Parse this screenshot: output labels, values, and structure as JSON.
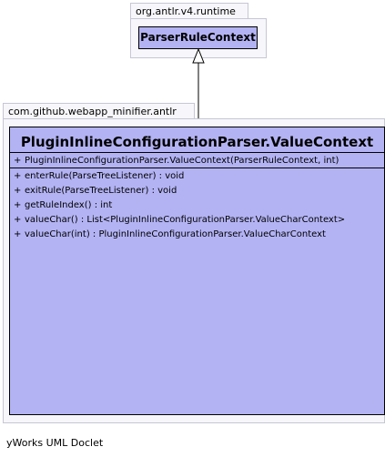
{
  "packages": {
    "runtime": {
      "label": "org.antlr.v4.runtime"
    },
    "minifier": {
      "label": "com.github.webapp_minifier.antlr"
    }
  },
  "parent_class": {
    "name": "ParserRuleContext"
  },
  "main_class": {
    "name": "PluginInlineConfigurationParser.ValueContext",
    "constructors": [
      {
        "visibility": "+",
        "signature": "PluginInlineConfigurationParser.ValueContext(ParserRuleContext, int)"
      }
    ],
    "methods": [
      {
        "visibility": "+",
        "signature": "enterRule(ParseTreeListener) : void"
      },
      {
        "visibility": "+",
        "signature": "exitRule(ParseTreeListener) : void"
      },
      {
        "visibility": "+",
        "signature": "getRuleIndex() : int"
      },
      {
        "visibility": "+",
        "signature": "valueChar() : List<PluginInlineConfigurationParser.ValueCharContext>"
      },
      {
        "visibility": "+",
        "signature": "valueChar(int) : PluginInlineConfigurationParser.ValueCharContext"
      }
    ]
  },
  "footer": {
    "text": "yWorks UML Doclet"
  }
}
